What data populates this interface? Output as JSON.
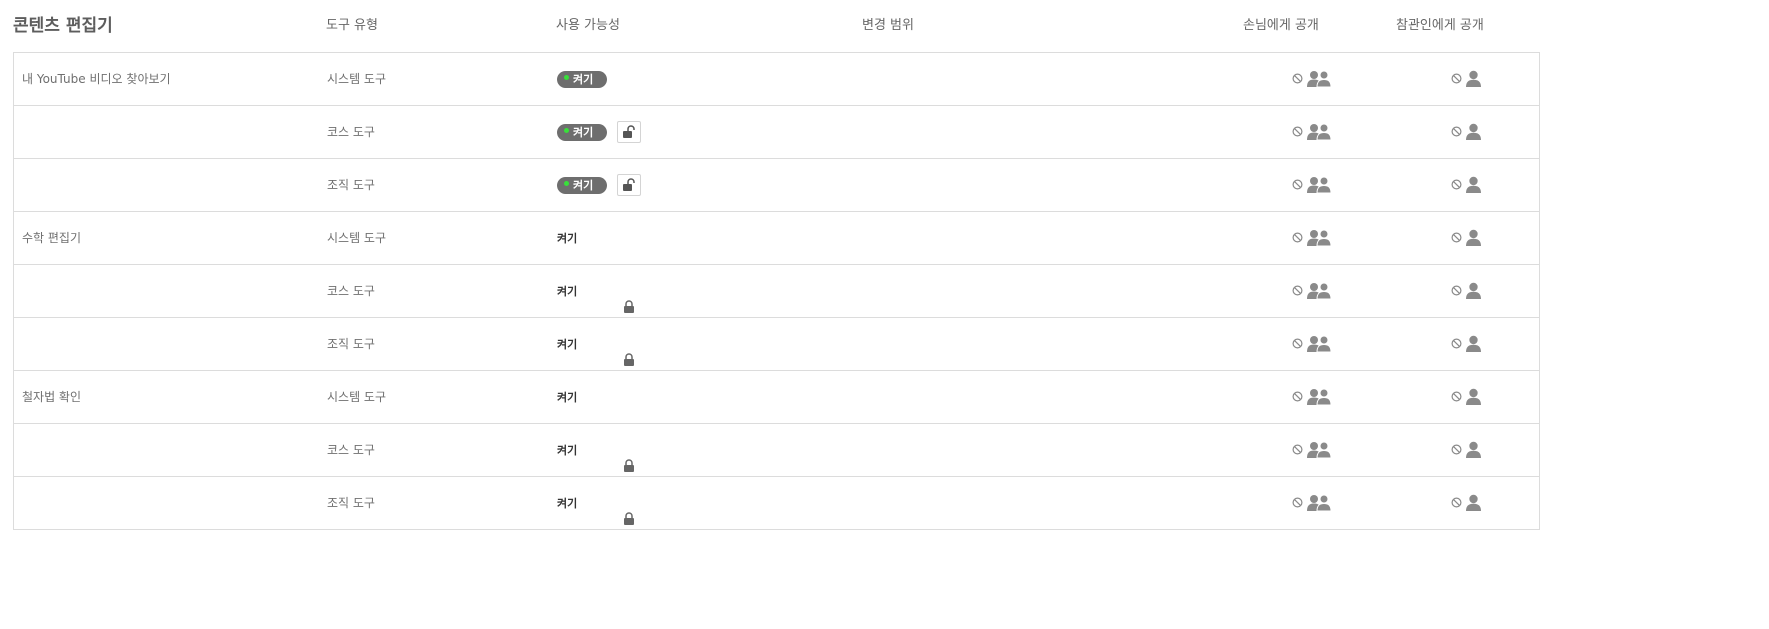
{
  "header": {
    "editor": "콘텐츠 편집기",
    "tool_type": "도구 유형",
    "availability": "사용 가능성",
    "change_scope": "변경 범위",
    "guest_visible": "손님에게 공개",
    "observer_visible": "참관인에게 공개"
  },
  "rows": [
    {
      "editor": "내 YouTube 비디오 찾아보기",
      "tool_type": "시스템 도구",
      "availability": "켜기",
      "style": "toggle",
      "lock": "none"
    },
    {
      "editor": "",
      "tool_type": "코스 도구",
      "availability": "켜기",
      "style": "toggle",
      "lock": "unlocked"
    },
    {
      "editor": "",
      "tool_type": "조직 도구",
      "availability": "켜기",
      "style": "toggle",
      "lock": "unlocked"
    },
    {
      "editor": "수학 편집기",
      "tool_type": "시스템 도구",
      "availability": "켜기",
      "style": "plain",
      "lock": "none"
    },
    {
      "editor": "",
      "tool_type": "코스 도구",
      "availability": "켜기",
      "style": "plain",
      "lock": "locked"
    },
    {
      "editor": "",
      "tool_type": "조직 도구",
      "availability": "켜기",
      "style": "plain",
      "lock": "locked"
    },
    {
      "editor": "철자법 확인",
      "tool_type": "시스템 도구",
      "availability": "켜기",
      "style": "plain",
      "lock": "none"
    },
    {
      "editor": "",
      "tool_type": "코스 도구",
      "availability": "켜기",
      "style": "plain",
      "lock": "locked"
    },
    {
      "editor": "",
      "tool_type": "조직 도구",
      "availability": "켜기",
      "style": "plain",
      "lock": "locked"
    }
  ],
  "icons": {
    "guest": "not-visible-group-icon",
    "observer": "not-visible-user-icon",
    "lock_open": "unlock-icon",
    "lock_closed": "lock-icon"
  },
  "colors": {
    "toggle_bg": "#6e6e6e",
    "toggle_dot": "#38e03a",
    "border": "#dcdcdc",
    "icon": "#8a8a8a"
  }
}
